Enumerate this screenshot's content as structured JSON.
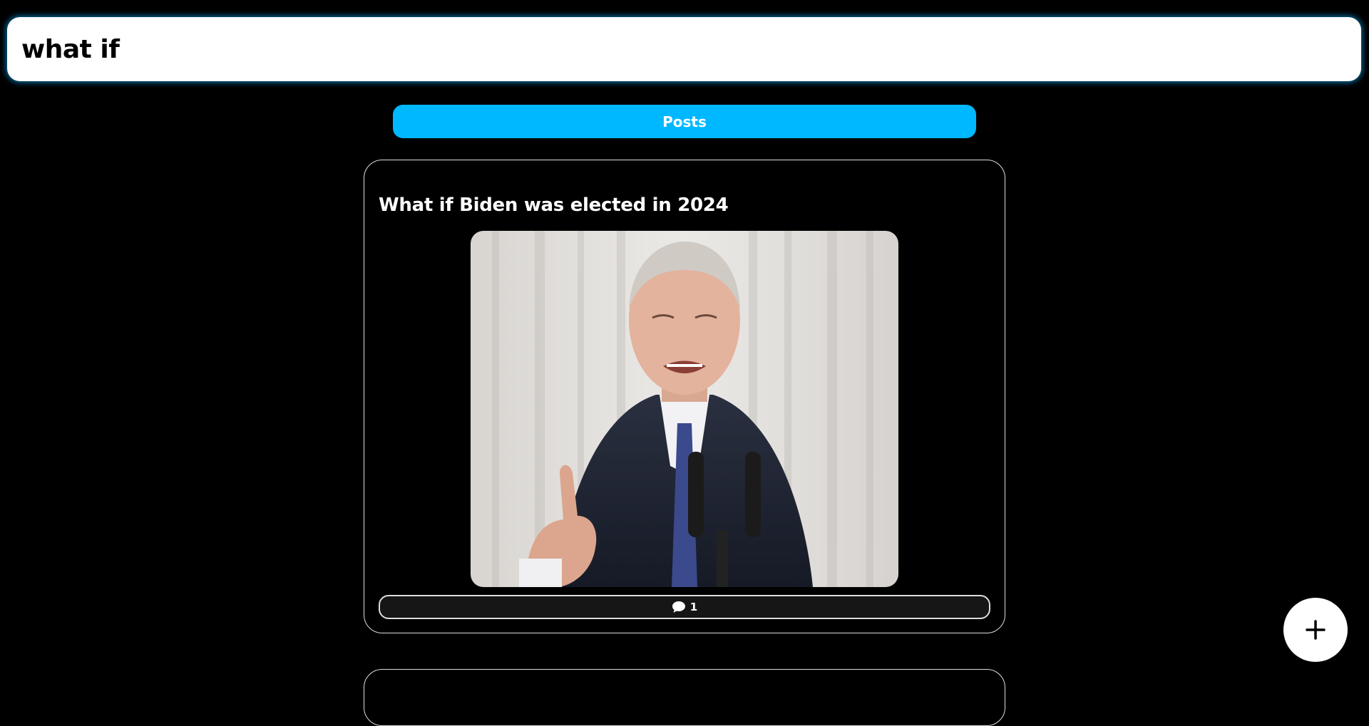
{
  "search": {
    "value": "what if"
  },
  "tabs": [
    {
      "label": "Posts"
    }
  ],
  "posts": [
    {
      "title": "What if Biden was elected in 2024",
      "comment_count": "1",
      "image_alt": "Biden at podium"
    }
  ],
  "icons": {
    "comment": "comment-icon",
    "add": "plus-icon"
  },
  "colors": {
    "background": "#000000",
    "accent": "#00b8ff",
    "search_glow": "#0096dc"
  }
}
